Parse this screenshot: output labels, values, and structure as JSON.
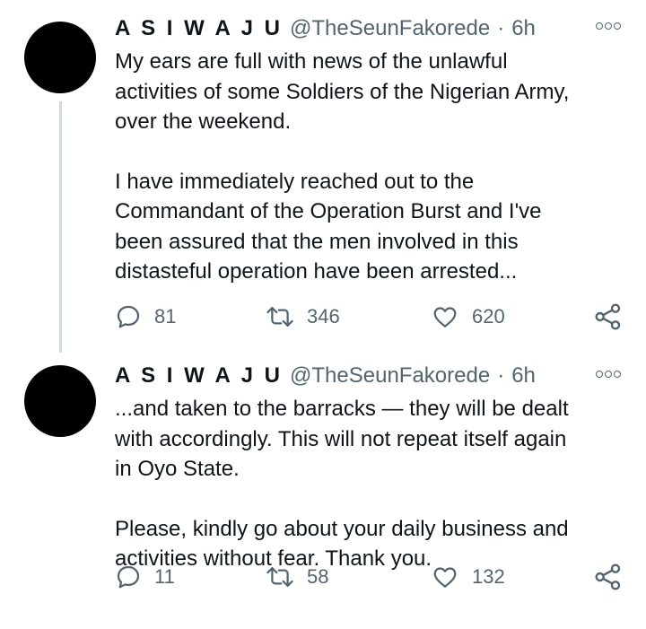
{
  "tweets": [
    {
      "name": "A S I W A J U",
      "handle": "@TheSeunFakorede",
      "separator": "·",
      "time": "6h",
      "paragraphs": [
        "My ears are full with news of the unlawful\nactivities of some Soldiers of the Nigerian Army,\nover the weekend.",
        "I have immediately reached out to the\nCommandant of the Operation Burst and I've\nbeen assured that the men involved in this\ndistasteful operation have been arrested..."
      ],
      "replies": "81",
      "retweets": "346",
      "likes": "620"
    },
    {
      "name": "A S I W A J U",
      "handle": "@TheSeunFakorede",
      "separator": "·",
      "time": "6h",
      "paragraphs": [
        "...and taken to the barracks — they will be dealt\nwith accordingly. This will not repeat itself again\nin Oyo State.",
        "Please, kindly go about your daily business and\nactivities without fear. Thank you."
      ],
      "replies": "11",
      "retweets": "58",
      "likes": "132"
    }
  ],
  "colors": {
    "text": "#0f1419",
    "secondary": "#536471",
    "thread_line": "#cfd9de",
    "avatar": "#000000"
  },
  "icons": {
    "reply": "reply-icon",
    "retweet": "retweet-icon",
    "like": "like-icon",
    "share": "share-icon",
    "more": "more-icon"
  }
}
